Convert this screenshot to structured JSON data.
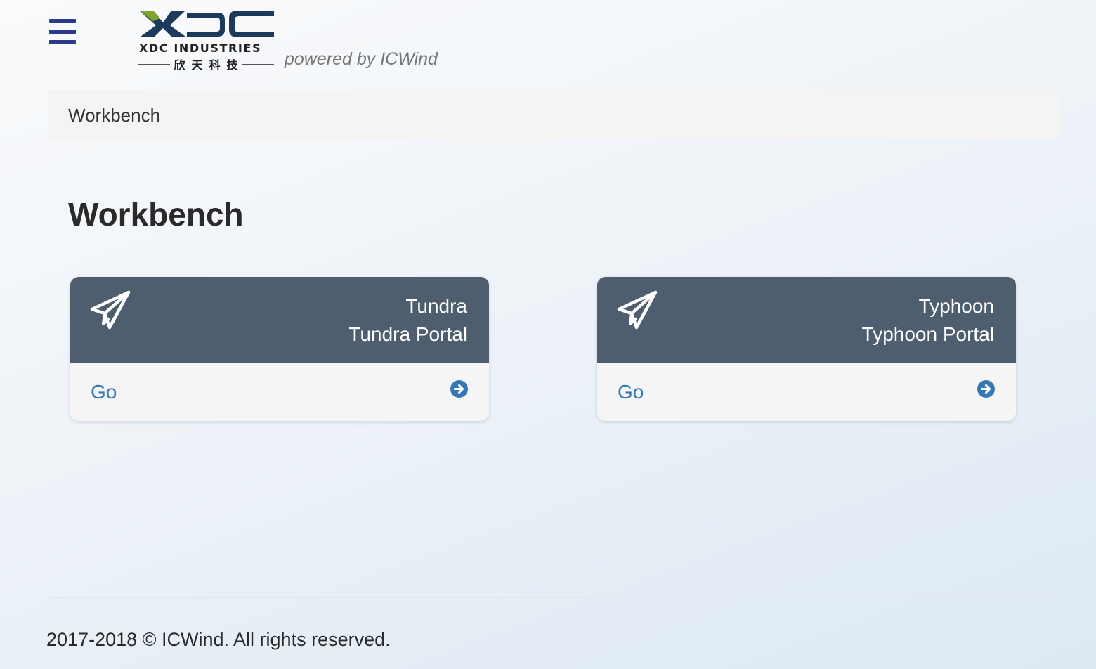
{
  "header": {
    "menu_icon": "hamburger-menu-icon",
    "logo": {
      "mark": "XDC",
      "name": "XDC INDUSTRIES",
      "name_cn": "欣天科技",
      "colors": {
        "navy": "#1d3a5c",
        "green": "#7ea32e"
      }
    },
    "powered_by": "powered by ICWind",
    "menu_color": "#2b3a8c"
  },
  "breadcrumb": {
    "current": "Workbench"
  },
  "page": {
    "title": "Workbench"
  },
  "cards": [
    {
      "icon": "paper-plane-icon",
      "title": "Tundra",
      "subtitle": "Tundra Portal",
      "action_label": "Go",
      "action_icon": "arrow-circle-right-icon"
    },
    {
      "icon": "paper-plane-icon",
      "title": "Typhoon",
      "subtitle": "Typhoon Portal",
      "action_label": "Go",
      "action_icon": "arrow-circle-right-icon"
    }
  ],
  "footer": {
    "copyright": "2017-2018 © ICWind. All rights reserved."
  },
  "colors": {
    "card_header": "#4f5e6e",
    "link": "#3577b3",
    "breadcrumb_bg": "#f4f4f4"
  }
}
